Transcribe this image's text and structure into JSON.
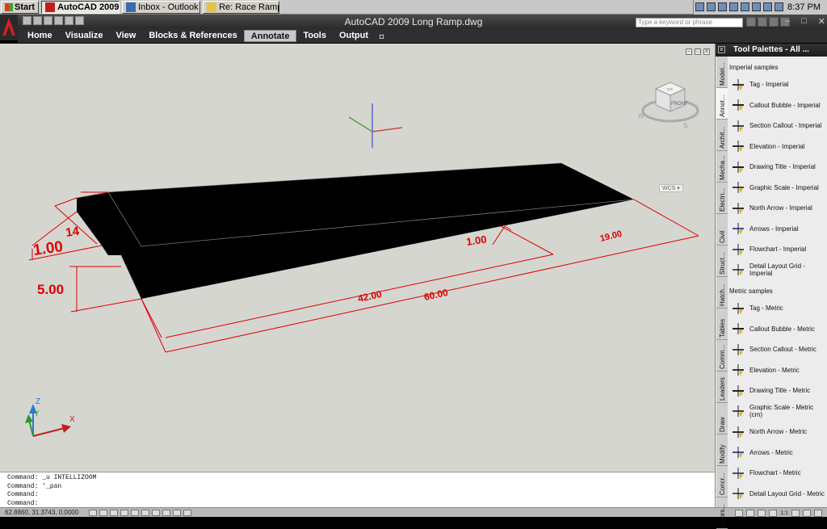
{
  "taskbar": {
    "start_label": "Start",
    "tasks": [
      {
        "label": "AutoCAD 2009 ...",
        "active": true,
        "icon": "autocad-icon"
      },
      {
        "label": "Inbox - Outlook ...",
        "active": false,
        "icon": "outlook-icon"
      },
      {
        "label": "Re: Race Ramps",
        "active": false,
        "icon": "mail-icon"
      }
    ],
    "clock": "8:37 PM"
  },
  "app": {
    "title": "AutoCAD 2009  Long Ramp.dwg",
    "search_placeholder": "Type a keyword or phrase"
  },
  "ribbon": {
    "tabs": [
      "Home",
      "Visualize",
      "View",
      "Blocks & References",
      "Annotate",
      "Tools",
      "Output"
    ],
    "active_tab": "Annotate"
  },
  "viewport": {
    "viewcube_face": "FRONT",
    "viewcube_top": "TOP",
    "compass": {
      "w": "W",
      "s": "S"
    },
    "wcs_label": "WCS ▾",
    "ucs": {
      "x": "X",
      "y": "Y",
      "z": "Z"
    },
    "dimensions": {
      "d_1": "1.00",
      "d_14": "14",
      "d_5": "5.00",
      "d_1b": "1.00",
      "d_42": "42.00",
      "d_60": "60.00",
      "d_19": "19.00"
    },
    "colors": {
      "dimension": "#dd0000",
      "ramp": "#000000",
      "background": "#d6d6d0"
    }
  },
  "command_line": {
    "lines": [
      "Command: _u INTELLIZOOM",
      "Command: '_pan",
      "Command:",
      "Command:"
    ]
  },
  "status": {
    "coords": "62.8860, 31.3743, 0.0000",
    "scale": "1:1"
  },
  "palette": {
    "title": "Tool Palettes - All ...",
    "tabs": [
      "Model...",
      "Annot...",
      "Archit...",
      "Mecha...",
      "Electri...",
      "Civil",
      "Struct...",
      "Hatch...",
      "Tables",
      "Comm...",
      "Leaders",
      "Draw",
      "Modify",
      "Concr...",
      "Doors..."
    ],
    "sections": [
      {
        "title": "Imperial samples",
        "tools": [
          "Tag - Imperial",
          "Callout Bubble - Imperial",
          "Section Callout - Imperial",
          "Elevation - Imperial",
          "Drawing Title - Imperial",
          "Graphic Scale - Imperial",
          "North Arrow - Imperial",
          "Arrows - Imperial",
          "Flowchart - Imperial",
          "Detail Layout Grid - Imperial"
        ]
      },
      {
        "title": "Metric samples",
        "tools": [
          "Tag - Metric",
          "Callout Bubble - Metric",
          "Section Callout - Metric",
          "Elevation - Metric",
          "Drawing Title - Metric",
          "Graphic Scale - Metric (cm)",
          "North Arrow  - Metric",
          "Arrows - Metric",
          "Flowchart - Metric",
          "Detail Layout Grid - Metric"
        ]
      }
    ]
  }
}
